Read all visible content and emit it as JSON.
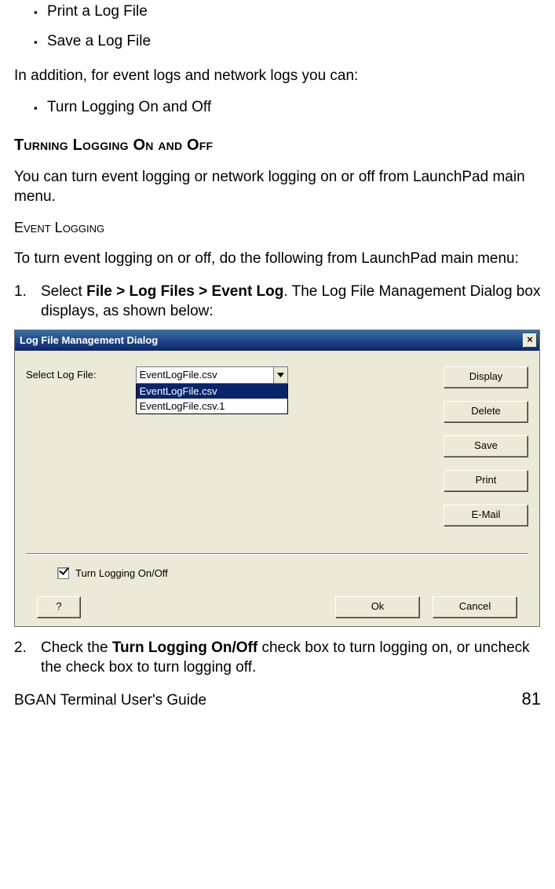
{
  "bullets_a": [
    "Print a Log File",
    "Save a Log File"
  ],
  "para_a": "In addition, for event logs and network logs you can:",
  "bullets_b": [
    "Turn Logging On and Off"
  ],
  "heading_turning": "Turning Logging On and Off",
  "para_b": "You can turn event logging or network logging on or off from LaunchPad main menu.",
  "subheading_event": "Event Logging",
  "para_c": "To turn event logging on or off, do the following from LaunchPad main menu:",
  "step1": {
    "num": "1.",
    "pre": "Select ",
    "bold": "File > Log Files > Event Log",
    "post": ". The Log File Management Dialog box displays, as shown below:"
  },
  "dialog": {
    "title": "Log File Management Dialog",
    "close_glyph": "×",
    "label_select": "Select Log File:",
    "combo_value": "EventLogFile.csv",
    "options": [
      "EventLogFile.csv",
      "EventLogFile.csv.1"
    ],
    "buttons": {
      "display": "Display",
      "delete": "Delete",
      "save": "Save",
      "print": "Print",
      "email": "E-Mail",
      "help": "?",
      "ok": "Ok",
      "cancel": "Cancel"
    },
    "checkbox_label": "Turn Logging On/Off",
    "checkbox_checked": true
  },
  "step2": {
    "num": "2.",
    "pre": "Check the ",
    "bold": "Turn Logging On/Off",
    "post": " check box to turn logging on, or uncheck the check box to turn logging off."
  },
  "footer": {
    "doc": "BGAN Terminal User's Guide",
    "page": "81"
  }
}
